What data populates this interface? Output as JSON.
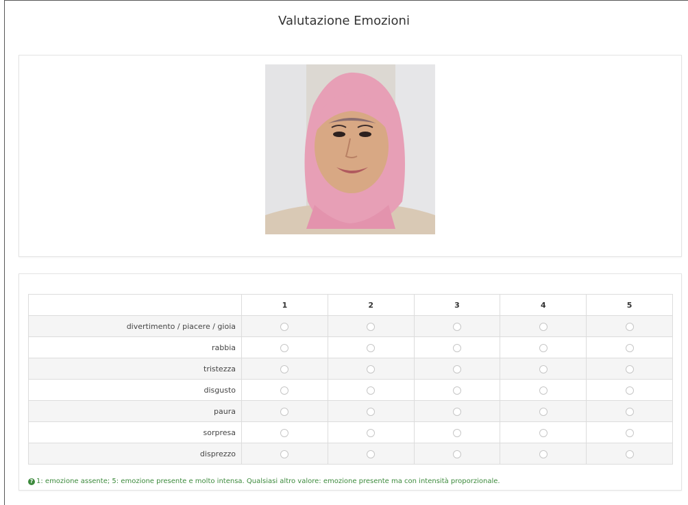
{
  "page": {
    "title": "Valutazione Emozioni"
  },
  "image": {
    "alt": "face"
  },
  "table": {
    "columns": [
      "1",
      "2",
      "3",
      "4",
      "5"
    ],
    "rows": [
      {
        "label": "divertimento / piacere / gioia"
      },
      {
        "label": "rabbia"
      },
      {
        "label": "tristezza"
      },
      {
        "label": "disgusto"
      },
      {
        "label": "paura"
      },
      {
        "label": "sorpresa"
      },
      {
        "label": "disprezzo"
      }
    ]
  },
  "help": {
    "icon": "question-circle-icon",
    "text": "1: emozione assente; 5: emozione presente e molto intensa. Qualsiasi altro valore: emozione presente ma con intensità proporzionale."
  },
  "colors": {
    "help_text": "#3c8a3c",
    "border": "#dcdcdc",
    "stripe": "#f5f5f5"
  }
}
